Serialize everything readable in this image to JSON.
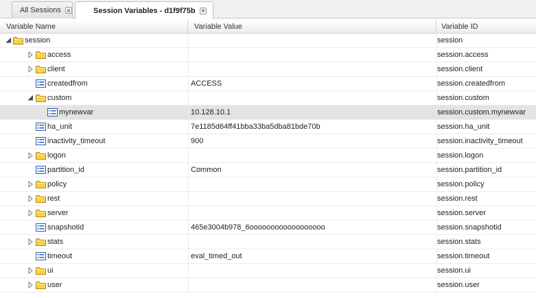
{
  "tabs": [
    {
      "label": "All Sessions",
      "active": false
    },
    {
      "label": "Session Variables - d1f9f75b",
      "active": true
    }
  ],
  "columns": {
    "name": "Variable Name",
    "value": "Variable Value",
    "id": "Variable ID"
  },
  "rows": [
    {
      "name": "session",
      "value": "",
      "id": "session",
      "type": "folder",
      "level": 0,
      "state": "expanded",
      "selected": false
    },
    {
      "name": "access",
      "value": "",
      "id": "session.access",
      "type": "folder",
      "level": 1,
      "state": "collapsed",
      "selected": false
    },
    {
      "name": "client",
      "value": "",
      "id": "session.client",
      "type": "folder",
      "level": 1,
      "state": "collapsed",
      "selected": false
    },
    {
      "name": "createdfrom",
      "value": "ACCESS",
      "id": "session.createdfrom",
      "type": "leaf",
      "level": 1,
      "state": "none",
      "selected": false
    },
    {
      "name": "custom",
      "value": "",
      "id": "session.custom",
      "type": "folder",
      "level": 1,
      "state": "expanded",
      "selected": false
    },
    {
      "name": "mynewvar",
      "value": "10.128.10.1",
      "id": "session.custom.mynewvar",
      "type": "leaf",
      "level": 2,
      "state": "none",
      "selected": true
    },
    {
      "name": "ha_unit",
      "value": "7e1185d64ff41bba33ba5dba81bde70b",
      "id": "session.ha_unit",
      "type": "leaf",
      "level": 1,
      "state": "none",
      "selected": false
    },
    {
      "name": "inactivity_timeout",
      "value": "900",
      "id": "session.inactivity_timeout",
      "type": "leaf",
      "level": 1,
      "state": "none",
      "selected": false
    },
    {
      "name": "logon",
      "value": "",
      "id": "session.logon",
      "type": "folder",
      "level": 1,
      "state": "collapsed",
      "selected": false
    },
    {
      "name": "partition_id",
      "value": "Common",
      "id": "session.partition_id",
      "type": "leaf",
      "level": 1,
      "state": "none",
      "selected": false
    },
    {
      "name": "policy",
      "value": "",
      "id": "session.policy",
      "type": "folder",
      "level": 1,
      "state": "collapsed",
      "selected": false
    },
    {
      "name": "rest",
      "value": "",
      "id": "session.rest",
      "type": "folder",
      "level": 1,
      "state": "collapsed",
      "selected": false
    },
    {
      "name": "server",
      "value": "",
      "id": "session.server",
      "type": "folder",
      "level": 1,
      "state": "collapsed",
      "selected": false
    },
    {
      "name": "snapshotid",
      "value": "465e3004b978_6oooooooooooooooooo",
      "id": "session.snapshotid",
      "type": "leaf",
      "level": 1,
      "state": "none",
      "selected": false
    },
    {
      "name": "stats",
      "value": "",
      "id": "session.stats",
      "type": "folder",
      "level": 1,
      "state": "collapsed",
      "selected": false
    },
    {
      "name": "timeout",
      "value": "eval_timed_out",
      "id": "session.timeout",
      "type": "leaf",
      "level": 1,
      "state": "none",
      "selected": false
    },
    {
      "name": "ui",
      "value": "",
      "id": "session.ui",
      "type": "folder",
      "level": 1,
      "state": "collapsed",
      "selected": false
    },
    {
      "name": "user",
      "value": "",
      "id": "session.user",
      "type": "folder",
      "level": 1,
      "state": "collapsed",
      "selected": false
    }
  ],
  "colors": {
    "selected_row": "#e3e3e3",
    "folder_fill": "#f7d24a",
    "folder_stroke": "#b8860b",
    "leaf_icon": "#2a5cab"
  }
}
